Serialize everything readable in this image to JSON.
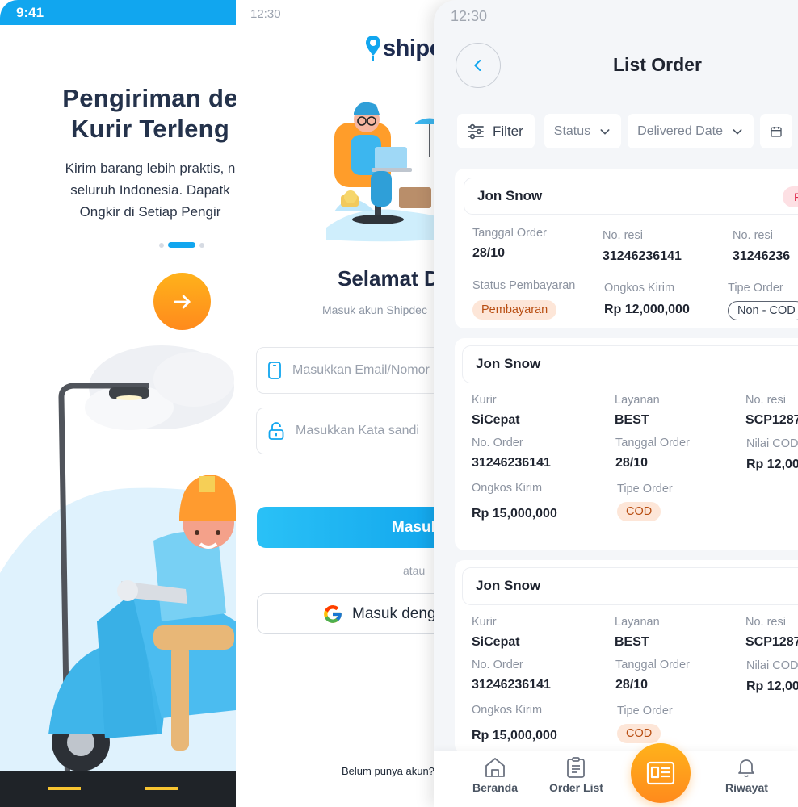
{
  "onboarding": {
    "status_time": "9:41",
    "title_line1": "Pengiriman de",
    "title_line2": "Kurir Terleng",
    "desc_line1": "Kirim barang lebih praktis, n",
    "desc_line2": "seluruh Indonesia. Dapatk",
    "desc_line3": "Ongkir di Setiap Pengir",
    "next_icon": "arrow-right-icon",
    "colors": {
      "primary": "#11a6ef",
      "accent": "#ff9a1c"
    }
  },
  "login": {
    "status_time": "12:30",
    "logo_text": "shipo",
    "welcome": "Selamat D",
    "subtitle": "Masuk akun Shipdec",
    "email_placeholder": "Masukkan Email/Nomor",
    "password_placeholder": "Masukkan Kata sandi",
    "login_button": "Masul",
    "or_text": "atau",
    "google_button": "Masuk deng",
    "signup_text": "Belum punya akun?"
  },
  "list_order": {
    "status_time": "12:30",
    "title": "List Order",
    "filters": {
      "filter_label": "Filter",
      "status_label": "Status",
      "delivered_date_label": "Delivered Date"
    },
    "card1": {
      "name": "Jon Snow",
      "badge": "F",
      "tanggal_order_label": "Tanggal Order",
      "tanggal_order": "28/10",
      "no_resi_label": "No. resi",
      "no_resi": "31246236141",
      "no_resi2_label": "No. resi",
      "no_resi2": "31246236",
      "status_pembayaran_label": "Status Pembayaran",
      "status_pembayaran": "Pembayaran",
      "ongkos_kirim_label": "Ongkos Kirim",
      "ongkos_kirim": "Rp 12,000,000",
      "tipe_order_label": "Tipe Order",
      "tipe_order": "Non - COD"
    },
    "cards": [
      {
        "name": "Jon Snow",
        "kurir_label": "Kurir",
        "kurir": "SiCepat",
        "layanan_label": "Layanan",
        "layanan": "BEST",
        "no_resi_label": "No. resi",
        "no_resi": "SCP1287",
        "no_order_label": "No. Order",
        "no_order": "31246236141",
        "tanggal_order_label": "Tanggal Order",
        "tanggal_order": "28/10",
        "nilai_cod_label": "Nilai COD",
        "nilai_cod": "Rp 12,00",
        "ongkos_kirim_label": "Ongkos Kirim",
        "ongkos_kirim": "Rp 15,000,000",
        "tipe_order_label": "Tipe Order",
        "tipe_order": "COD"
      },
      {
        "name": "Jon Snow",
        "kurir_label": "Kurir",
        "kurir": "SiCepat",
        "layanan_label": "Layanan",
        "layanan": "BEST",
        "no_resi_label": "No. resi",
        "no_resi": "SCP1287",
        "no_order_label": "No. Order",
        "no_order": "31246236141",
        "tanggal_order_label": "Tanggal Order",
        "tanggal_order": "28/10",
        "nilai_cod_label": "Nilai COD",
        "nilai_cod": "Rp 12,00",
        "ongkos_kirim_label": "Ongkos Kirim",
        "ongkos_kirim": "Rp 15,000,000",
        "tipe_order_label": "Tipe Order",
        "tipe_order": "COD"
      }
    ],
    "nav": {
      "beranda": "Beranda",
      "order_list": "Order List",
      "riwayat": "Riwayat"
    }
  }
}
